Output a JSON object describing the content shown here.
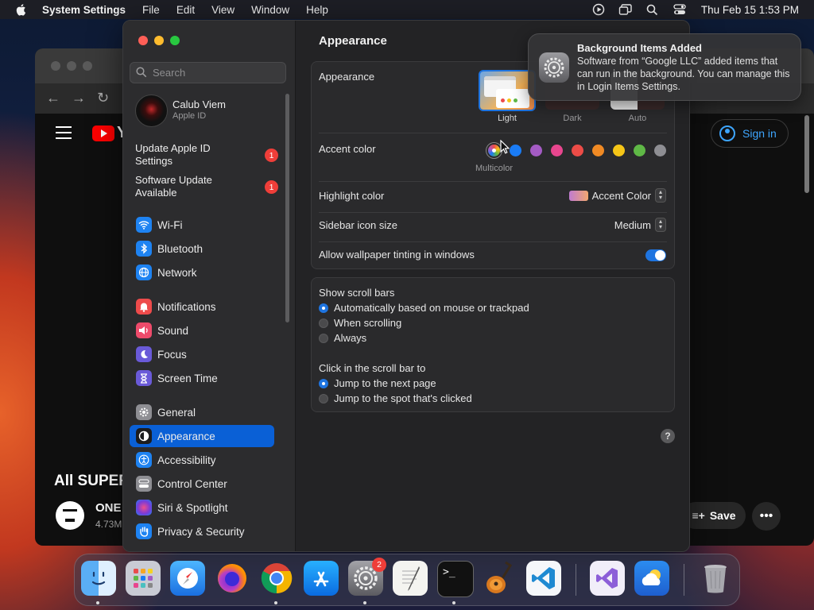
{
  "menubar": {
    "app": "System Settings",
    "items": [
      "File",
      "Edit",
      "View",
      "Window",
      "Help"
    ],
    "clock": "Thu Feb 15  1:53 PM"
  },
  "browser": {
    "sign_in": "Sign in",
    "video_title": "All SUPER",
    "channel": "ONE",
    "subs": "4.73M",
    "save": "Save"
  },
  "sidebar": {
    "search_placeholder": "Search",
    "account": {
      "name": "Calub Viem",
      "sub": "Apple ID"
    },
    "notices": [
      {
        "label": "Update Apple ID Settings",
        "badge": "1"
      },
      {
        "label": "Software Update Available",
        "badge": "1"
      }
    ],
    "items": [
      {
        "label": "Wi-Fi",
        "icon": "wifi-icon",
        "color": "#1e83f2"
      },
      {
        "label": "Bluetooth",
        "icon": "bluetooth-icon",
        "color": "#1e83f2"
      },
      {
        "label": "Network",
        "icon": "globe-icon",
        "color": "#1e83f2"
      },
      {
        "label": "Notifications",
        "icon": "bell-icon",
        "color": "#ee4b4b"
      },
      {
        "label": "Sound",
        "icon": "speaker-icon",
        "color": "#ee4b6b"
      },
      {
        "label": "Focus",
        "icon": "moon-icon",
        "color": "#6a5ad8"
      },
      {
        "label": "Screen Time",
        "icon": "hourglass-icon",
        "color": "#6a5ad8"
      },
      {
        "label": "General",
        "icon": "gear-icon",
        "color": "#8e8e93"
      },
      {
        "label": "Appearance",
        "icon": "appearance-icon",
        "color": "#1c1c1e",
        "selected": true
      },
      {
        "label": "Accessibility",
        "icon": "accessibility-icon",
        "color": "#1e83f2"
      },
      {
        "label": "Control Center",
        "icon": "control-center-icon",
        "color": "#8e8e93"
      },
      {
        "label": "Siri & Spotlight",
        "icon": "siri-icon",
        "color": "#b44ad8"
      },
      {
        "label": "Privacy & Security",
        "icon": "hand-icon",
        "color": "#1e83f2"
      }
    ]
  },
  "main": {
    "title": "Appearance",
    "appearance_label": "Appearance",
    "modes": [
      "Light",
      "Dark",
      "Auto"
    ],
    "accent_label": "Accent color",
    "accent_selected": "Multicolor",
    "accent_colors": [
      "#1a7cf5",
      "#a45bc4",
      "#e8468e",
      "#ec4c47",
      "#f08a24",
      "#f5c517",
      "#5fb846",
      "#8e8e93"
    ],
    "highlight_label": "Highlight color",
    "highlight_value": "Accent Color",
    "icon_size_label": "Sidebar icon size",
    "icon_size_value": "Medium",
    "tinting_label": "Allow wallpaper tinting in windows",
    "scroll_title": "Show scroll bars",
    "scroll_options": [
      "Automatically based on mouse or trackpad",
      "When scrolling",
      "Always"
    ],
    "click_title": "Click in the scroll bar to",
    "click_options": [
      "Jump to the next page",
      "Jump to the spot that's clicked"
    ],
    "help": "?"
  },
  "notification": {
    "title": "Background Items Added",
    "body": "Software from “Google LLC” added items that can run in the background. You can manage this in Login Items Settings."
  },
  "dock": {
    "apps": [
      "Finder",
      "Launchpad",
      "Safari",
      "Firefox",
      "Chrome",
      "App Store",
      "System Settings",
      "TextEdit",
      "Terminal",
      "GarageBand",
      "Visual Studio Code",
      "Visual Studio",
      "Weather",
      "Trash"
    ],
    "settings_badge": "2"
  }
}
